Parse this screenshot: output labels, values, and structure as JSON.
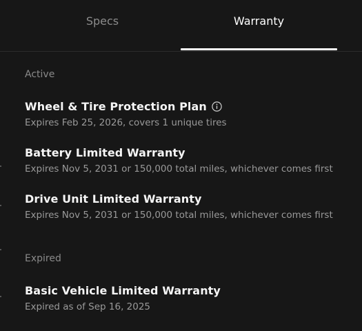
{
  "tabs": [
    {
      "label": "Specs",
      "active": false
    },
    {
      "label": "Warranty",
      "active": true
    }
  ],
  "sections": {
    "active_label": "Active",
    "expired_label": "Expired"
  },
  "active_items": [
    {
      "title": "Wheel & Tire Protection Plan",
      "subtitle": "Expires Feb 25, 2026, covers 1 unique tires",
      "icon": "info-icon"
    },
    {
      "title": "Battery Limited Warranty",
      "subtitle": "Expires Nov 5, 2031 or 150,000 total miles, whichever comes first"
    },
    {
      "title": "Drive Unit Limited Warranty",
      "subtitle": "Expires Nov 5, 2031 or 150,000 total miles, whichever comes first"
    }
  ],
  "expired_items": [
    {
      "title": "Basic Vehicle Limited Warranty",
      "subtitle": "Expired as of Sep 16, 2025"
    }
  ]
}
